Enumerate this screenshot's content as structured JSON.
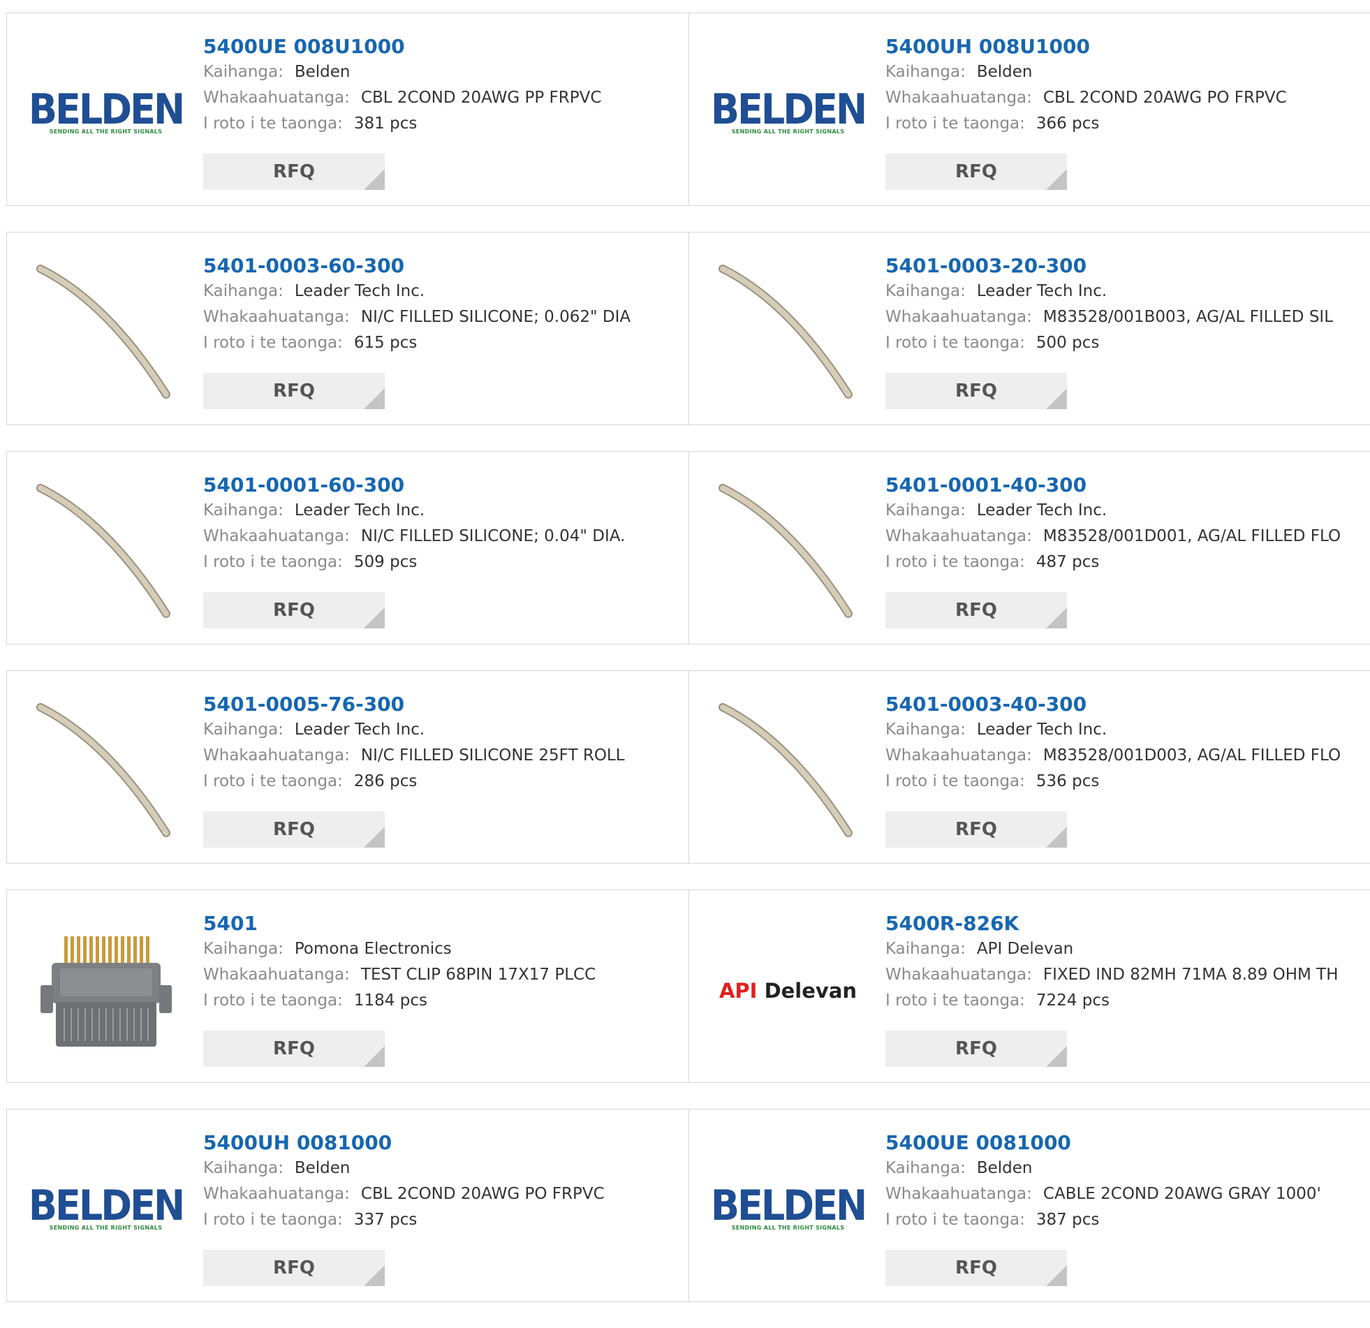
{
  "labels": {
    "manufacturer": "Kaihanga:",
    "description": "Whakaahuatanga:",
    "stock": "I roto i te taonga:",
    "rfq": "RFQ"
  },
  "brands": {
    "belden_word": "BELDEN",
    "belden_tagline": "SENDING ALL THE RIGHT SIGNALS",
    "api_a": "API",
    "api_b": "Delevan"
  },
  "colors": {
    "part_link": "#1666b0",
    "belden_blue": "#1f4e93",
    "belden_green": "#2e8b3c",
    "api_red": "#e02020"
  },
  "products": [
    {
      "part": "5400UE 008U1000",
      "manufacturer": "Belden",
      "description": "CBL 2COND 20AWG PP FRPVC",
      "stock": "381 pcs",
      "image": "belden-logo"
    },
    {
      "part": "5400UH 008U1000",
      "manufacturer": "Belden",
      "description": "CBL 2COND 20AWG PO FRPVC",
      "stock": "366 pcs",
      "image": "belden-logo"
    },
    {
      "part": "5401-0003-60-300",
      "manufacturer": "Leader Tech Inc.",
      "description": "NI/C FILLED SILICONE; 0.062\" DIA",
      "stock": "615 pcs",
      "image": "silicone-cord"
    },
    {
      "part": "5401-0003-20-300",
      "manufacturer": "Leader Tech Inc.",
      "description": "M83528/001B003, AG/AL FILLED SIL",
      "stock": "500 pcs",
      "image": "silicone-cord"
    },
    {
      "part": "5401-0001-60-300",
      "manufacturer": "Leader Tech Inc.",
      "description": "NI/C FILLED SILICONE; 0.04\" DIA.",
      "stock": "509 pcs",
      "image": "silicone-cord"
    },
    {
      "part": "5401-0001-40-300",
      "manufacturer": "Leader Tech Inc.",
      "description": "M83528/001D001, AG/AL FILLED FLO",
      "stock": "487 pcs",
      "image": "silicone-cord"
    },
    {
      "part": "5401-0005-76-300",
      "manufacturer": "Leader Tech Inc.",
      "description": "NI/C FILLED SILICONE 25FT ROLL",
      "stock": "286 pcs",
      "image": "silicone-cord"
    },
    {
      "part": "5401-0003-40-300",
      "manufacturer": "Leader Tech Inc.",
      "description": "M83528/001D003, AG/AL FILLED FLO",
      "stock": "536 pcs",
      "image": "silicone-cord"
    },
    {
      "part": "5401",
      "manufacturer": "Pomona Electronics",
      "description": "TEST CLIP 68PIN 17X17 PLCC",
      "stock": "1184 pcs",
      "image": "test-clip"
    },
    {
      "part": "5400R-826K",
      "manufacturer": "API Delevan",
      "description": "FIXED IND 82MH 71MA 8.89 OHM TH",
      "stock": "7224 pcs",
      "image": "api-delevan-logo"
    },
    {
      "part": "5400UH 0081000",
      "manufacturer": "Belden",
      "description": "CBL 2COND 20AWG PO FRPVC",
      "stock": "337 pcs",
      "image": "belden-logo"
    },
    {
      "part": "5400UE 0081000",
      "manufacturer": "Belden",
      "description": "CABLE 2COND 20AWG GRAY 1000'",
      "stock": "387 pcs",
      "image": "belden-logo"
    }
  ]
}
